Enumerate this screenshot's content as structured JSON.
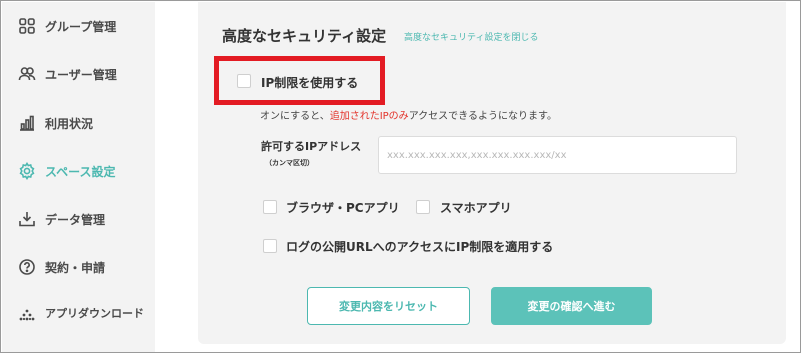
{
  "sidebar": {
    "items": [
      {
        "label": "グループ管理",
        "icon": "grid-icon"
      },
      {
        "label": "ユーザー管理",
        "icon": "users-icon"
      },
      {
        "label": "利用状況",
        "icon": "bar-chart-icon"
      },
      {
        "label": "スペース設定",
        "icon": "gear-icon",
        "active": true
      },
      {
        "label": "データ管理",
        "icon": "download-tray-icon"
      },
      {
        "label": "契約・申請",
        "icon": "question-circle-icon"
      },
      {
        "label": "アプリダウンロード",
        "icon": "app-dots-icon"
      }
    ]
  },
  "section": {
    "title": "高度なセキュリティ設定",
    "close_link": "高度なセキュリティ設定を閉じる"
  },
  "ip_restriction": {
    "label": "IP制限を使用する",
    "checked": false,
    "desc_prefix": "オンにすると、",
    "desc_highlight": "追加されたIPのみ",
    "desc_suffix": "アクセスできるようになります。",
    "allowed_label": "許可するIPアドレス",
    "allowed_sub": "（カンマ区切）",
    "input_value": "",
    "input_placeholder": "xxx.xxx.xxx.xxx,xxx.xxx.xxx.xxx/xx"
  },
  "options": {
    "browser_pc": "ブラウザ・PCアプリ",
    "smartphone": "スマホアプリ",
    "log_url": "ログの公開URLへのアクセスにIP制限を適用する"
  },
  "buttons": {
    "reset": "変更内容をリセット",
    "confirm": "変更の確認へ進む"
  },
  "colors": {
    "accent": "#4cb8b0",
    "primary_button": "#5cc2b9",
    "highlight_border": "#e31b23",
    "warning_text": "#e3332b",
    "panel_bg": "#f3f3f3"
  }
}
